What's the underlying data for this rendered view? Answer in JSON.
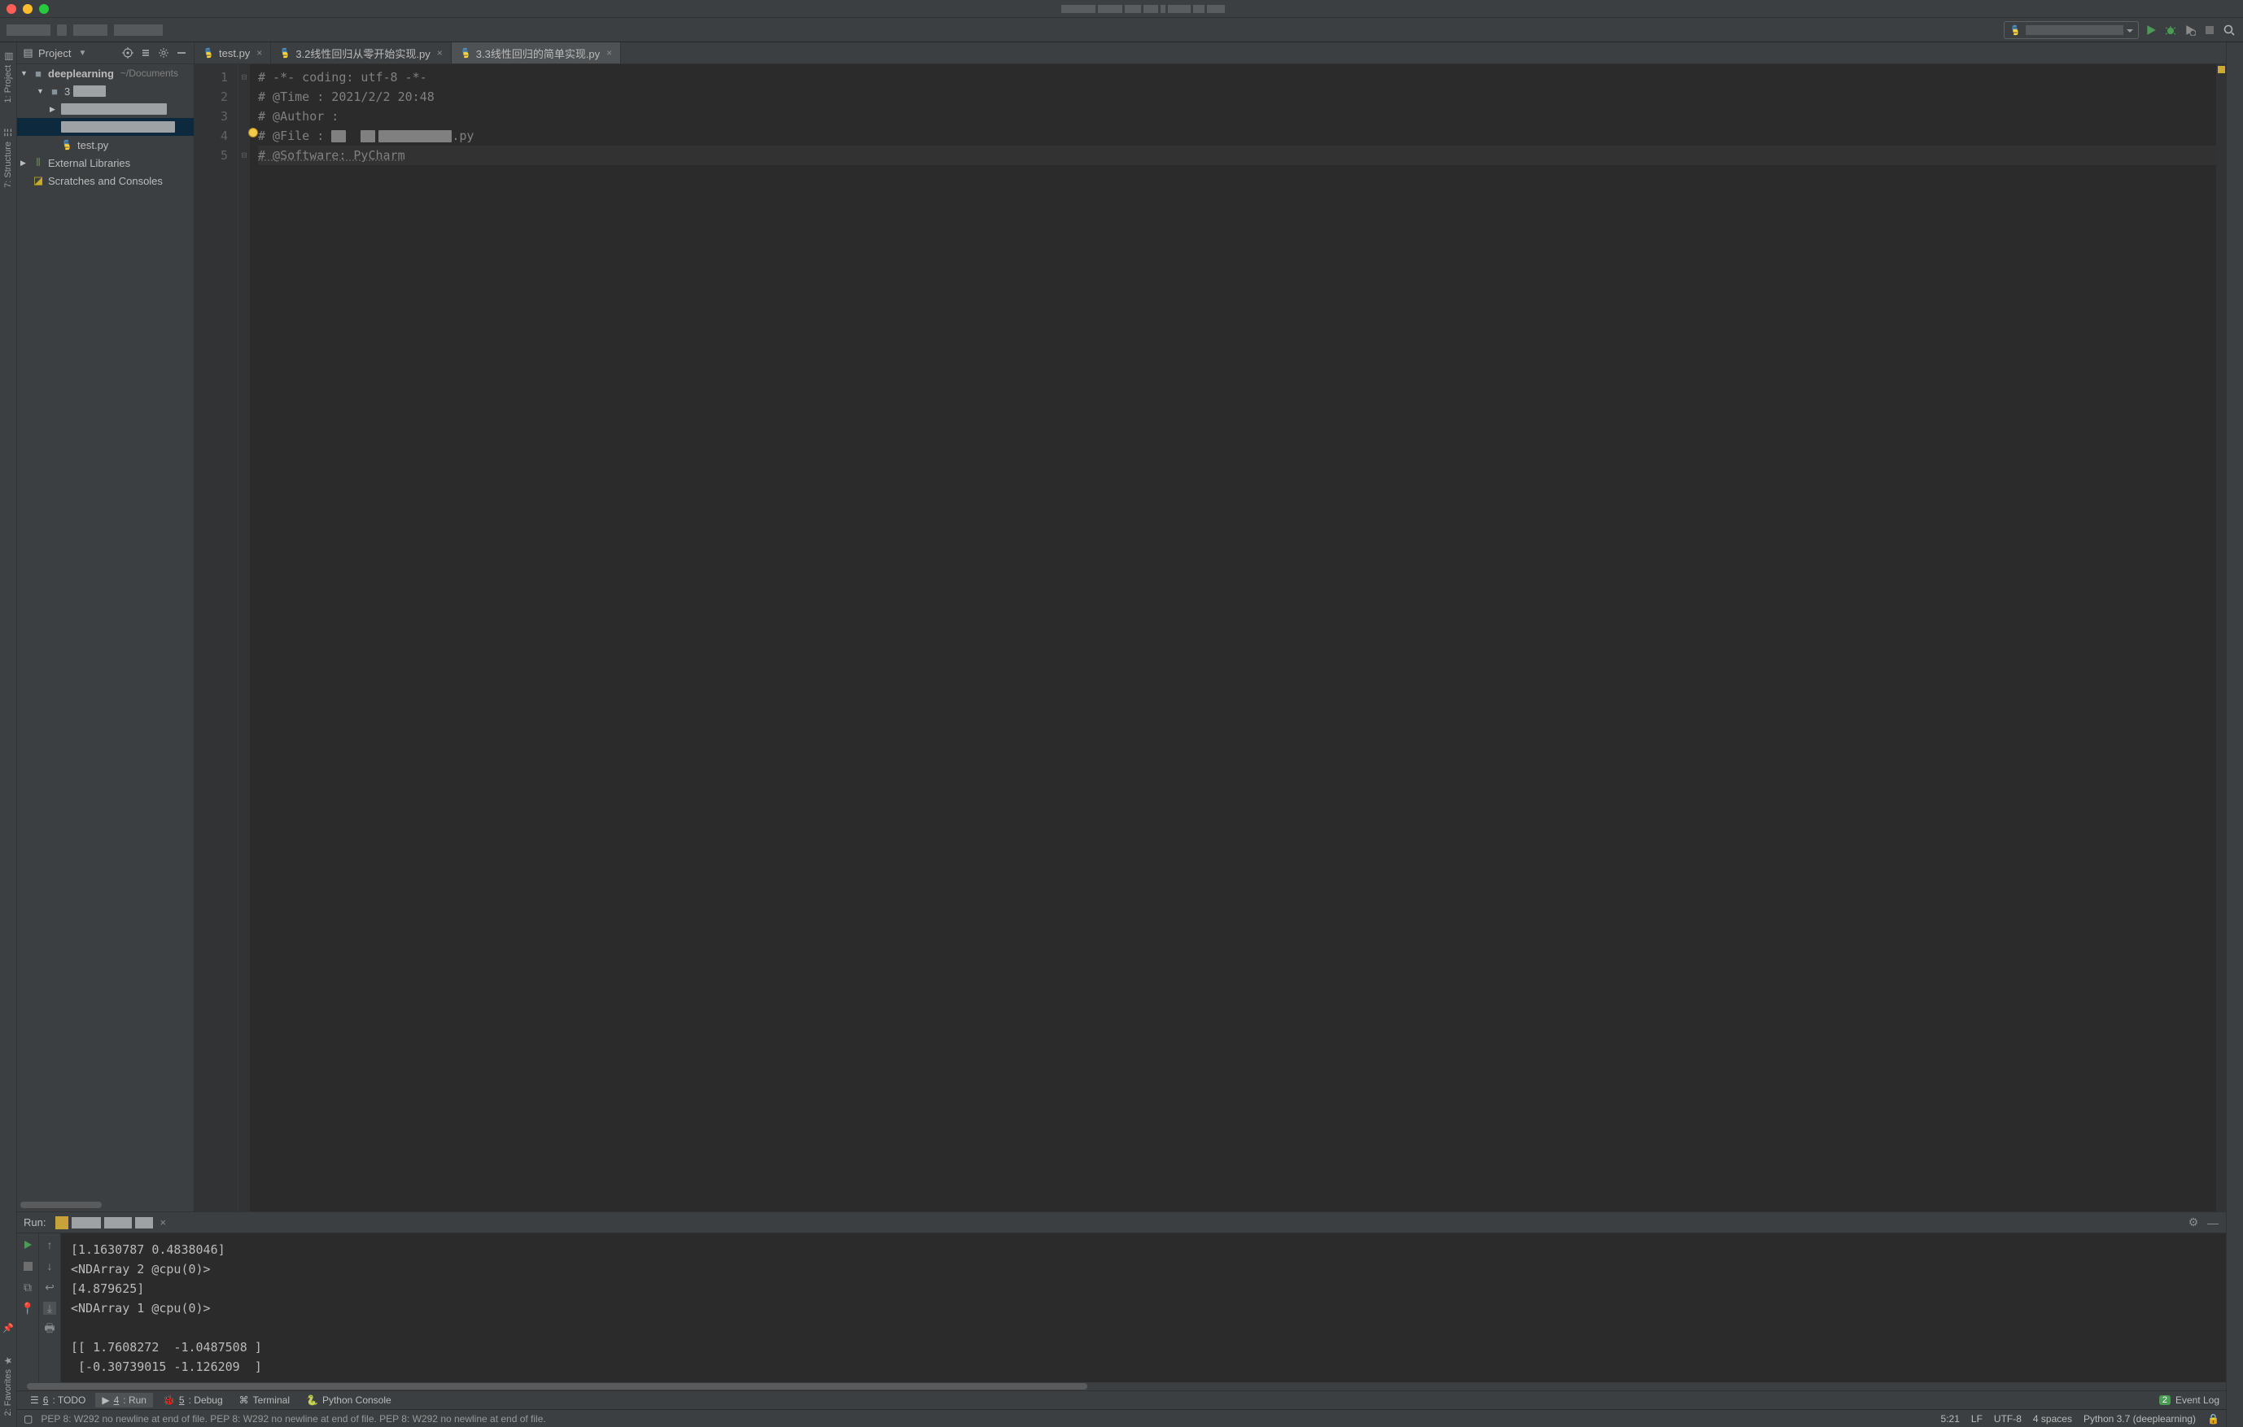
{
  "titlebar": {
    "traffic": [
      "close",
      "minimize",
      "zoom"
    ]
  },
  "toolbar": {
    "run_icon": "run",
    "debug_icon": "debug",
    "coverage_icon": "coverage",
    "stop_icon": "stop",
    "search_icon": "search"
  },
  "project_panel": {
    "title": "Project",
    "actions": [
      "locate",
      "collapse-vertical",
      "settings",
      "hide"
    ],
    "root": {
      "name": "deeplearning",
      "path": "~/Documents"
    },
    "files": {
      "test_py": "test.py"
    },
    "external": "External Libraries",
    "scratches": "Scratches and Consoles"
  },
  "sidebar_left": {
    "project": "1: Project",
    "structure": "7: Structure",
    "favorites": "2: Favorites"
  },
  "tabs": [
    {
      "label": "test.py",
      "active": false
    },
    {
      "label": "3.2线性回归从零开始实现.py",
      "active": false
    },
    {
      "label": "3.3线性回归的简单实现.py",
      "active": true
    }
  ],
  "code_lines": [
    "# -*- coding: utf-8 -*-",
    "# @Time : 2021/2/2 20:48",
    "# @Author :",
    "# @File :",
    "# @Software: PyCharm"
  ],
  "code_line4_suffix": ".py",
  "line_numbers": [
    "1",
    "2",
    "3",
    "4",
    "5"
  ],
  "run_panel": {
    "label": "Run:",
    "console_output": "[1.1630787 0.4838046]\n<NDArray 2 @cpu(0)>\n[4.879625]\n<NDArray 1 @cpu(0)>\n\n[[ 1.7608272  -1.0487508 ]\n [-0.30739015 -1.126209  ]"
  },
  "bottom_tools": {
    "todo": {
      "num": "6",
      "label": ": TODO"
    },
    "run": {
      "num": "4",
      "label": ": Run"
    },
    "debug": {
      "num": "5",
      "label": ": Debug"
    },
    "terminal": "Terminal",
    "python_console": "Python Console",
    "event_log": "Event Log",
    "event_badge": "2"
  },
  "statusbar": {
    "msg": "PEP 8: W292 no newline at end of file. PEP 8: W292 no newline at end of file. PEP 8: W292 no newline at end of file.",
    "pos": "5:21",
    "le": "LF",
    "enc": "UTF-8",
    "indent": "4 spaces",
    "interp": "Python 3.7 (deeplearning)"
  }
}
